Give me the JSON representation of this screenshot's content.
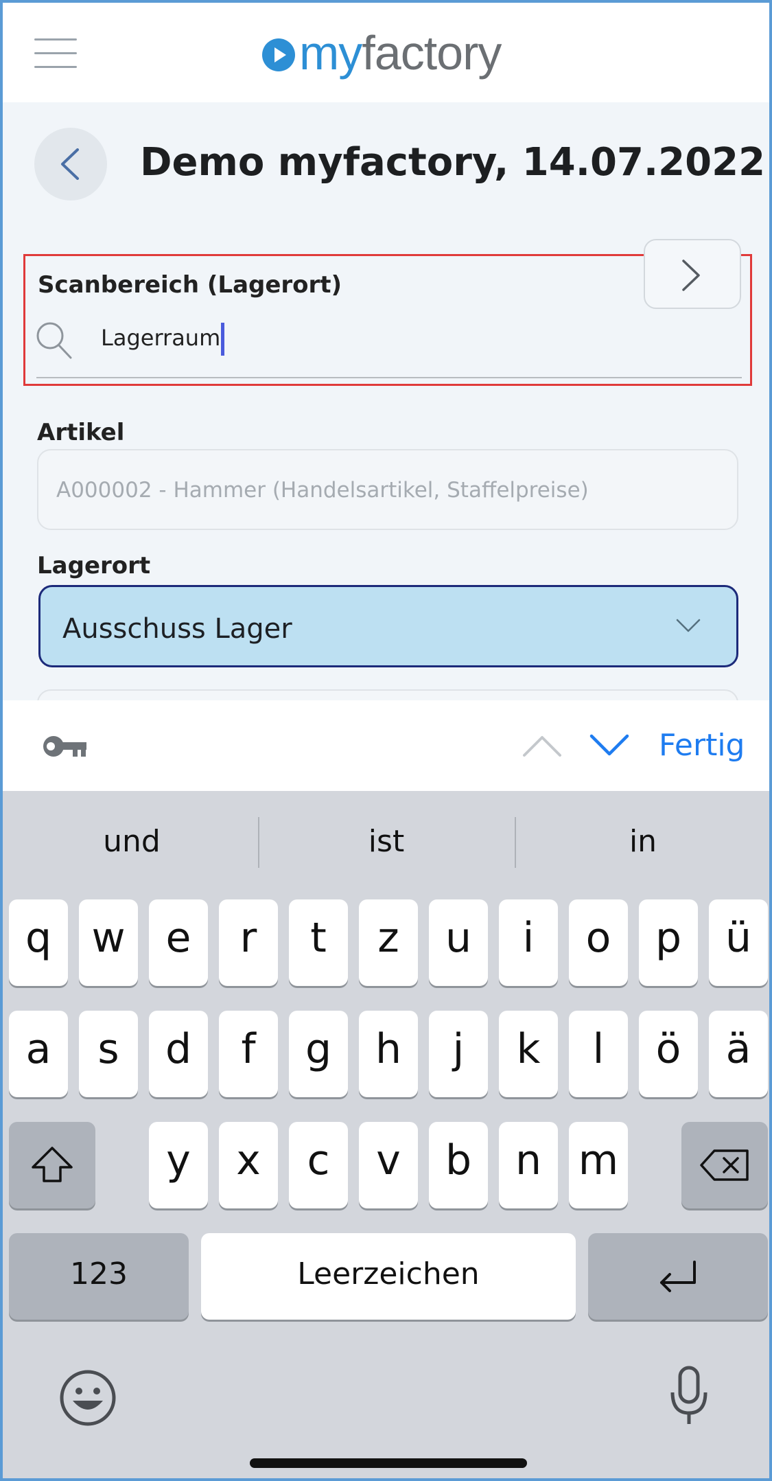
{
  "header": {
    "logo_prefix": "my",
    "logo_suffix": "factory",
    "menu_icon": "hamburger-icon"
  },
  "title_row": {
    "back_icon": "chevron-left-icon",
    "title": "Demo myfactory, 14.07.2022"
  },
  "scan_area": {
    "label": "Scanbereich (Lagerort)",
    "value": "Lagerraum",
    "search_icon": "search-icon",
    "next_icon": "chevron-right-icon",
    "highlight_color": "#e03a3a"
  },
  "artikel": {
    "label": "Artikel",
    "value": "A000002 - Hammer (Handelsartikel, Staffelpreise)"
  },
  "lagerort": {
    "label": "Lagerort",
    "value": "Ausschuss Lager",
    "background": "#bde0f2"
  },
  "keyboard_toolbar": {
    "key_icon": "key-icon",
    "done_label": "Fertig",
    "accent": "#1e7cf0"
  },
  "keyboard": {
    "suggestions": [
      "und",
      "ist",
      "in"
    ],
    "row1": [
      "q",
      "w",
      "e",
      "r",
      "t",
      "z",
      "u",
      "i",
      "o",
      "p",
      "ü"
    ],
    "row2": [
      "a",
      "s",
      "d",
      "f",
      "g",
      "h",
      "j",
      "k",
      "l",
      "ö",
      "ä"
    ],
    "row3": [
      "y",
      "x",
      "c",
      "v",
      "b",
      "n",
      "m"
    ],
    "numbers_label": "123",
    "space_label": "Leerzeichen",
    "shift_icon": "shift-icon",
    "backspace_icon": "backspace-icon",
    "return_icon": "return-icon",
    "emoji_icon": "emoji-icon",
    "mic_icon": "microphone-icon"
  }
}
